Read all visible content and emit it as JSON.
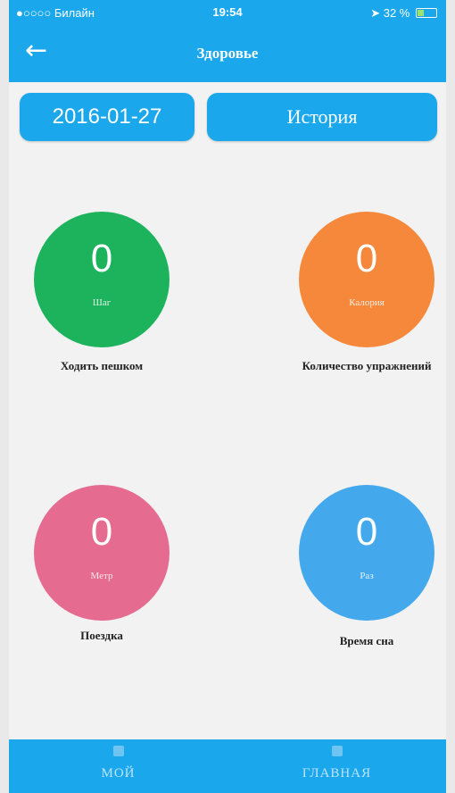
{
  "status": {
    "carrier": "●○○○○ Билайн",
    "time": "19:54",
    "battery": "32 %"
  },
  "nav": {
    "title": "Здоровье",
    "back_icon": "←"
  },
  "tabs": {
    "date": "2016-01-27",
    "history": "История"
  },
  "metrics": [
    {
      "value": "0",
      "unit": "Шаг",
      "label": "Ходить пешком",
      "color": "#1db35c"
    },
    {
      "value": "0",
      "unit": "Калория",
      "label": "Количество упражнений",
      "color": "#f5883b"
    },
    {
      "value": "0",
      "unit": "Метр",
      "label": "Поездка",
      "color": "#e56b90"
    },
    {
      "value": "0",
      "unit": "Раз",
      "label": "Время сна",
      "color": "#44a9ec"
    }
  ],
  "bottom": {
    "my": "МОЙ",
    "main": "ГЛАВНАЯ"
  },
  "colors": {
    "accent": "#1aa7ec"
  }
}
